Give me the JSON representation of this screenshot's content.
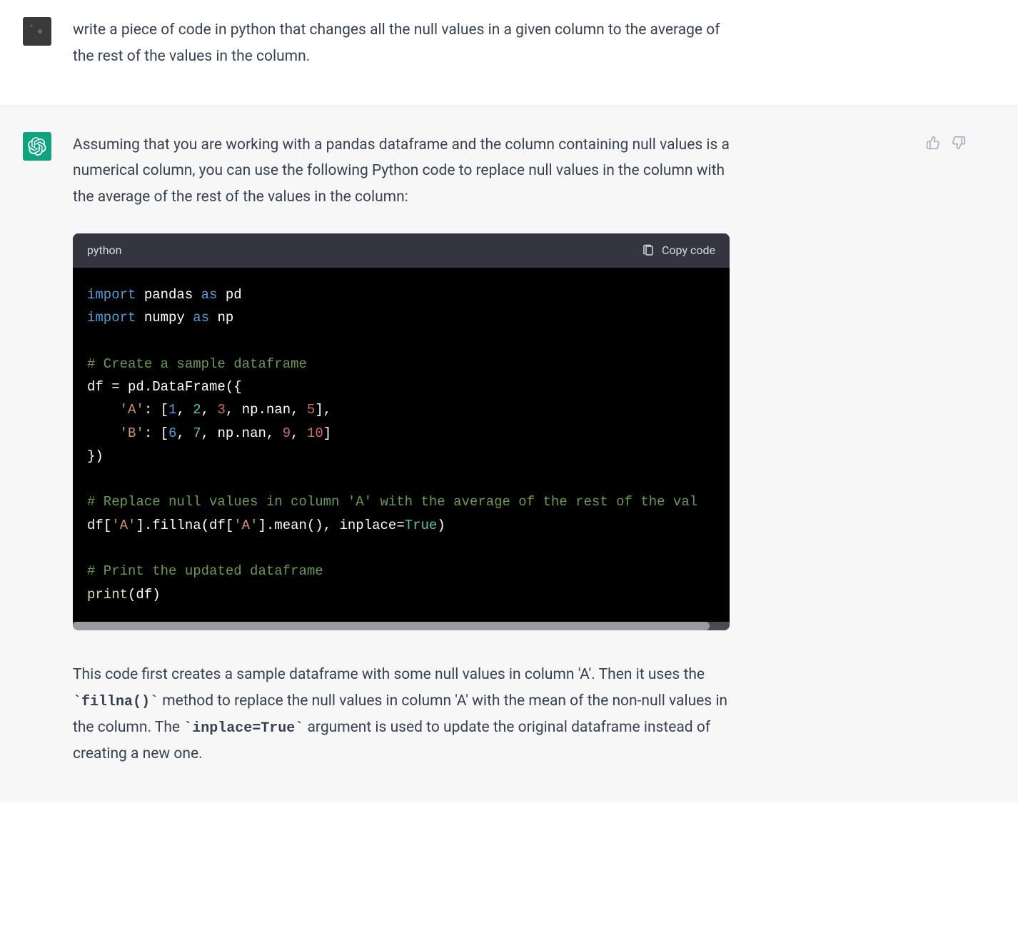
{
  "user_message": {
    "text": "write a piece of code in python that changes all the null values in a given column to the average of the rest of the values in the column."
  },
  "assistant_message": {
    "intro": "Assuming that you are working with a pandas dataframe and the column containing null values is a numerical column, you can use the following Python code to replace null values in the column with the average of the rest of the values in the column:",
    "outro_1": "This code first creates a sample dataframe with some null values in column 'A'. Then it uses the ",
    "outro_code1": "`fillna()`",
    "outro_2": " method to replace the null values in column 'A' with the mean of the non-null values in the column. The ",
    "outro_code2": "`inplace=True`",
    "outro_3": " argument is used to update the original dataframe instead of creating a new one."
  },
  "code_block": {
    "language": "python",
    "copy_label": "Copy code",
    "lines": {
      "l1_import": "import",
      "l1_pandas": " pandas ",
      "l1_as": "as",
      "l1_pd": " pd",
      "l2_import": "import",
      "l2_numpy": " numpy ",
      "l2_as": "as",
      "l2_np": " np",
      "l4_comment": "# Create a sample dataframe",
      "l5": "df = pd.DataFrame({",
      "l6_strA": "'A'",
      "l6_colon": ": [",
      "l6_1": "1",
      "l6_c1": ", ",
      "l6_2": "2",
      "l6_c2": ", ",
      "l6_3": "3",
      "l6_c3": ", np.nan, ",
      "l6_5": "5",
      "l6_end": "],",
      "l7_strB": "'B'",
      "l7_colon": ": [",
      "l7_6": "6",
      "l7_c1": ", ",
      "l7_7": "7",
      "l7_c2": ", np.nan, ",
      "l7_9": "9",
      "l7_c3": ", ",
      "l7_10": "10",
      "l7_end": "]",
      "l8": "})",
      "l10_comment": "# Replace null values in column 'A' with the average of the rest of the val",
      "l11_a": "df[",
      "l11_strA": "'A'",
      "l11_b": "].fillna(df[",
      "l11_strA2": "'A'",
      "l11_c": "].mean(), inplace=",
      "l11_true": "True",
      "l11_d": ")",
      "l13_comment": "# Print the updated dataframe",
      "l14_print": "print",
      "l14_rest": "(df)"
    }
  }
}
